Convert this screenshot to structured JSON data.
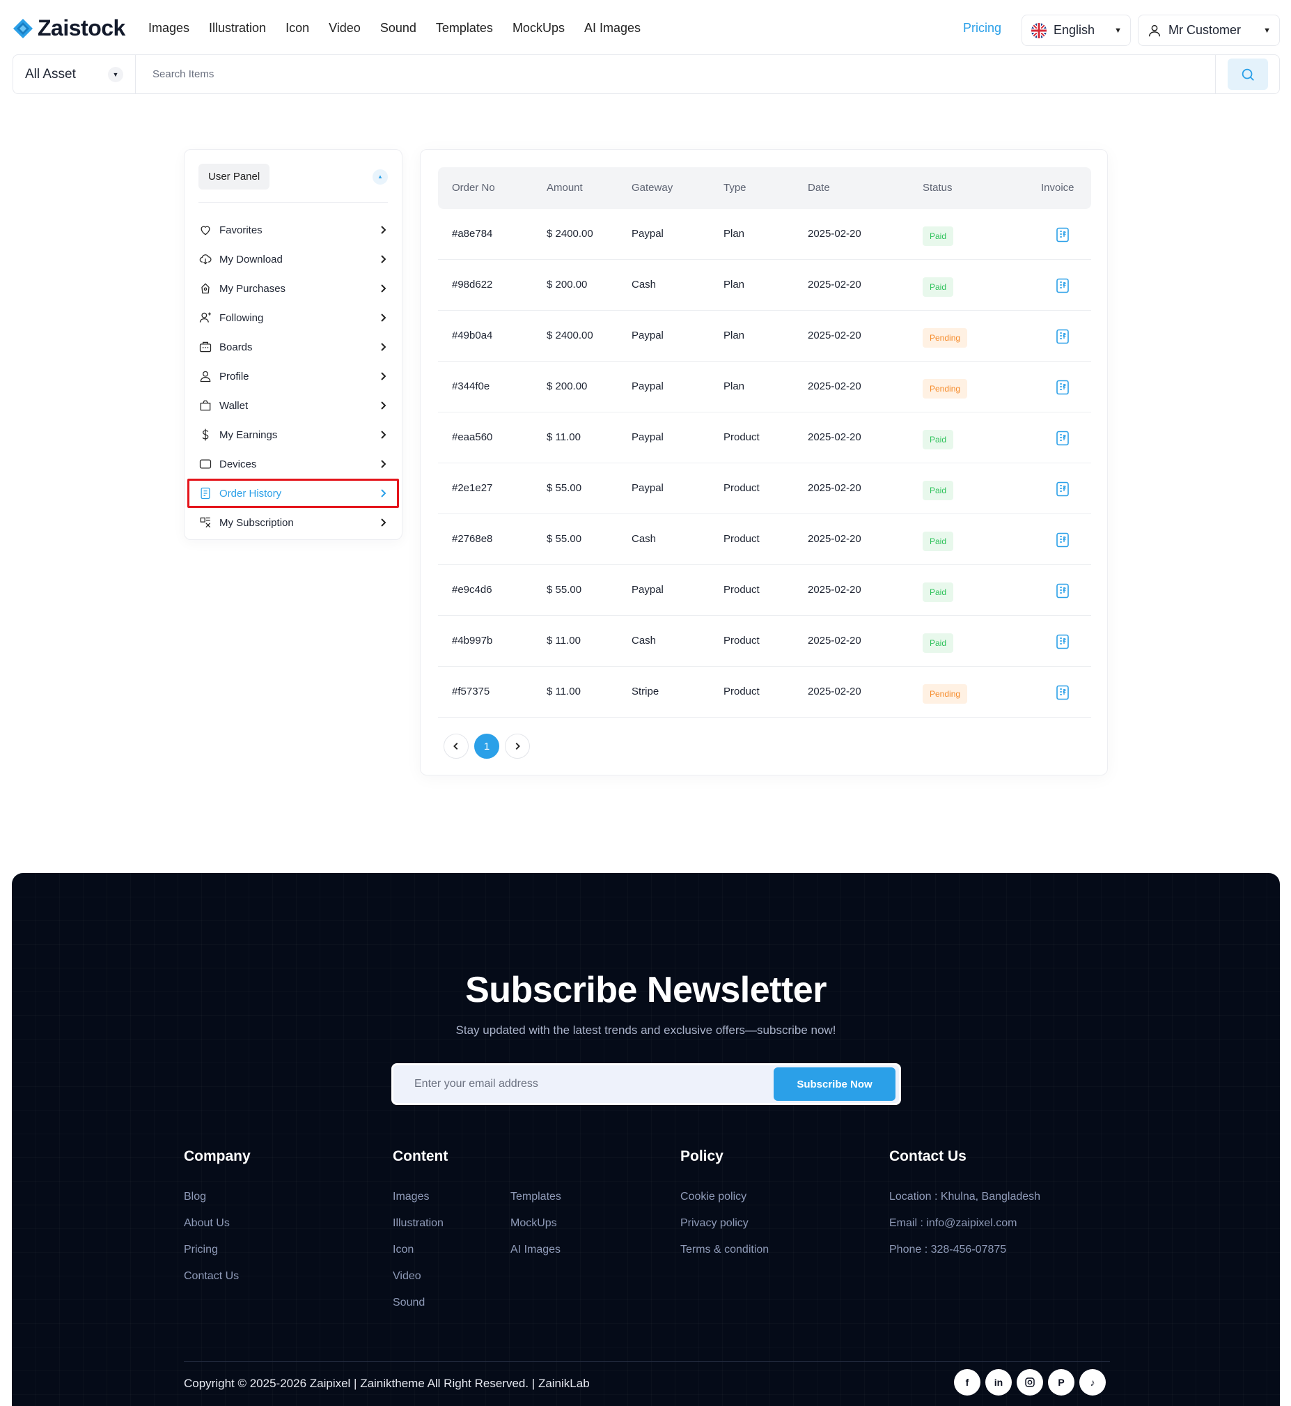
{
  "header": {
    "brand": "Zaistock",
    "nav": [
      "Images",
      "Illustration",
      "Icon",
      "Video",
      "Sound",
      "Templates",
      "MockUps",
      "AI Images"
    ],
    "pricing": "Pricing",
    "language": "English",
    "user": "Mr Customer",
    "accent_color": "#2ba0e8"
  },
  "search": {
    "category": "All Asset",
    "placeholder": "Search Items"
  },
  "sidebar": {
    "title": "User Panel",
    "items": [
      {
        "label": "Favorites",
        "icon": "heart-icon"
      },
      {
        "label": "My Download",
        "icon": "cloud-download-icon"
      },
      {
        "label": "My Purchases",
        "icon": "purchase-icon"
      },
      {
        "label": "Following",
        "icon": "user-plus-icon"
      },
      {
        "label": "Boards",
        "icon": "board-icon"
      },
      {
        "label": "Profile",
        "icon": "user-icon"
      },
      {
        "label": "Wallet",
        "icon": "wallet-icon"
      },
      {
        "label": "My Earnings",
        "icon": "dollar-icon"
      },
      {
        "label": "Devices",
        "icon": "device-icon"
      },
      {
        "label": "Order History",
        "icon": "receipt-icon",
        "active": true
      },
      {
        "label": "My Subscription",
        "icon": "subscription-icon"
      }
    ]
  },
  "orders": {
    "columns": [
      "Order No",
      "Amount",
      "Gateway",
      "Type",
      "Date",
      "Status",
      "Invoice"
    ],
    "rows": [
      {
        "order_no": "#a8e784",
        "amount": "$ 2400.00",
        "gateway": "Paypal",
        "type": "Plan",
        "date": "2025-02-20",
        "status": "Paid"
      },
      {
        "order_no": "#98d622",
        "amount": "$ 200.00",
        "gateway": "Cash",
        "type": "Plan",
        "date": "2025-02-20",
        "status": "Paid"
      },
      {
        "order_no": "#49b0a4",
        "amount": "$ 2400.00",
        "gateway": "Paypal",
        "type": "Plan",
        "date": "2025-02-20",
        "status": "Pending"
      },
      {
        "order_no": "#344f0e",
        "amount": "$ 200.00",
        "gateway": "Paypal",
        "type": "Plan",
        "date": "2025-02-20",
        "status": "Pending"
      },
      {
        "order_no": "#eaa560",
        "amount": "$ 11.00",
        "gateway": "Paypal",
        "type": "Product",
        "date": "2025-02-20",
        "status": "Paid"
      },
      {
        "order_no": "#2e1e27",
        "amount": "$ 55.00",
        "gateway": "Paypal",
        "type": "Product",
        "date": "2025-02-20",
        "status": "Paid"
      },
      {
        "order_no": "#2768e8",
        "amount": "$ 55.00",
        "gateway": "Cash",
        "type": "Product",
        "date": "2025-02-20",
        "status": "Paid"
      },
      {
        "order_no": "#e9c4d6",
        "amount": "$ 55.00",
        "gateway": "Paypal",
        "type": "Product",
        "date": "2025-02-20",
        "status": "Paid"
      },
      {
        "order_no": "#4b997b",
        "amount": "$ 11.00",
        "gateway": "Cash",
        "type": "Product",
        "date": "2025-02-20",
        "status": "Paid"
      },
      {
        "order_no": "#f57375",
        "amount": "$ 11.00",
        "gateway": "Stripe",
        "type": "Product",
        "date": "2025-02-20",
        "status": "Pending"
      }
    ],
    "pagination": {
      "current": "1"
    },
    "status_colors": {
      "Paid": "#2fc25b",
      "Pending": "#f68b2a"
    }
  },
  "newsletter": {
    "title": "Subscribe Newsletter",
    "subtitle": "Stay updated with the latest trends and exclusive offers—subscribe now!",
    "placeholder": "Enter your email address",
    "button": "Subscribe Now"
  },
  "footer": {
    "company": {
      "title": "Company",
      "links": [
        "Blog",
        "About Us",
        "Pricing",
        "Contact Us"
      ]
    },
    "content": {
      "title": "Content",
      "links": [
        "Images",
        "Illustration",
        "Icon",
        "Video",
        "Sound",
        "Templates",
        "MockUps",
        "AI Images"
      ]
    },
    "policy": {
      "title": "Policy",
      "links": [
        "Cookie policy",
        "Privacy policy",
        "Terms & condition"
      ]
    },
    "contact": {
      "title": "Contact Us",
      "lines": [
        "Location : Khulna, Bangladesh",
        "Email : info@zaipixel.com",
        "Phone : 328-456-07875"
      ]
    },
    "copyright": "Copyright © 2025-2026 Zaipixel | Zainiktheme All Right Reserved. | ZainikLab",
    "socials": [
      "facebook-icon",
      "linkedin-icon",
      "instagram-icon",
      "pinterest-icon",
      "tiktok-icon"
    ]
  }
}
